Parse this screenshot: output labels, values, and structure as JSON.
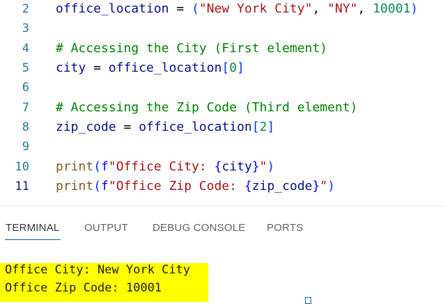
{
  "editor": {
    "line_numbers": [
      "2",
      "3",
      "4",
      "5",
      "6",
      "7",
      "8",
      "9",
      "10",
      "11"
    ],
    "line2": {
      "var": "office_location",
      "eq": " = ",
      "open": "(",
      "s1": "\"New York City\"",
      "c1": ", ",
      "s2": "\"NY\"",
      "c2": ", ",
      "num": "10001",
      "close": ")"
    },
    "line4": {
      "comment": "# Accessing the City (First element)"
    },
    "line5": {
      "var": "city",
      "eq": " = ",
      "ref": "office_location",
      "open": "[",
      "idx": "0",
      "close": "]"
    },
    "line7": {
      "comment": "# Accessing the Zip Code (Third element)"
    },
    "line8": {
      "var": "zip_code",
      "eq": " = ",
      "ref": "office_location",
      "open": "[",
      "idx": "2",
      "close": "]"
    },
    "line10": {
      "fn": "print",
      "open": "(",
      "prefix": "f",
      "str1": "\"Office City: ",
      "b_open": "{",
      "var": "city",
      "b_close": "}",
      "str2": "\"",
      "close": ")"
    },
    "line11": {
      "fn": "print",
      "open": "(",
      "prefix": "f",
      "str1": "\"Office Zip Code: ",
      "b_open": "{",
      "var": "zip_code",
      "b_close": "}",
      "str2": "\"",
      "close": ")"
    }
  },
  "panel": {
    "tabs": [
      "TERMINAL",
      "OUTPUT",
      "DEBUG CONSOLE",
      "PORTS"
    ],
    "active_tab": "TERMINAL",
    "terminal_lines": [
      "Office City: New York City",
      "Office Zip Code: 10001"
    ]
  },
  "colors": {
    "highlight": "#ffff00",
    "accent": "#005fb8",
    "string": "#a31515",
    "number": "#098658",
    "comment": "#008000",
    "variable": "#001080"
  }
}
